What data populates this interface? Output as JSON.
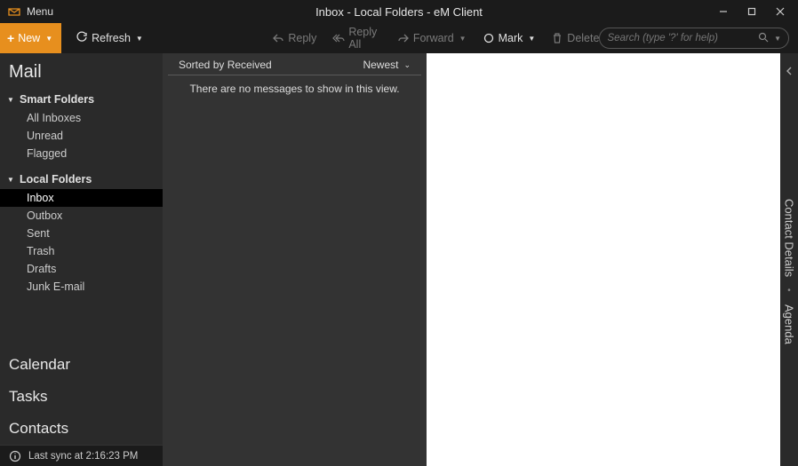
{
  "titlebar": {
    "menu": "Menu",
    "title": "Inbox - Local Folders - eM Client"
  },
  "toolbar": {
    "new": "New",
    "refresh": "Refresh",
    "reply": "Reply",
    "replyAll": "Reply All",
    "forward": "Forward",
    "mark": "Mark",
    "delete": "Delete",
    "searchPlaceholder": "Search (type '?' for help)"
  },
  "sidebar": {
    "mail": "Mail",
    "smartFolders": "Smart Folders",
    "smartItems": [
      "All Inboxes",
      "Unread",
      "Flagged"
    ],
    "localFolders": "Local Folders",
    "localItems": [
      "Inbox",
      "Outbox",
      "Sent",
      "Trash",
      "Drafts",
      "Junk E-mail"
    ],
    "activeLocal": "Inbox",
    "calendar": "Calendar",
    "tasks": "Tasks",
    "contacts": "Contacts"
  },
  "list": {
    "sortedBy": "Sorted by Received",
    "order": "Newest",
    "empty": "There are no messages to show in this view."
  },
  "rightbar": {
    "contactDetails": "Contact Details",
    "agenda": "Agenda"
  },
  "status": {
    "lastSync": "Last sync at 2:16:23 PM"
  }
}
